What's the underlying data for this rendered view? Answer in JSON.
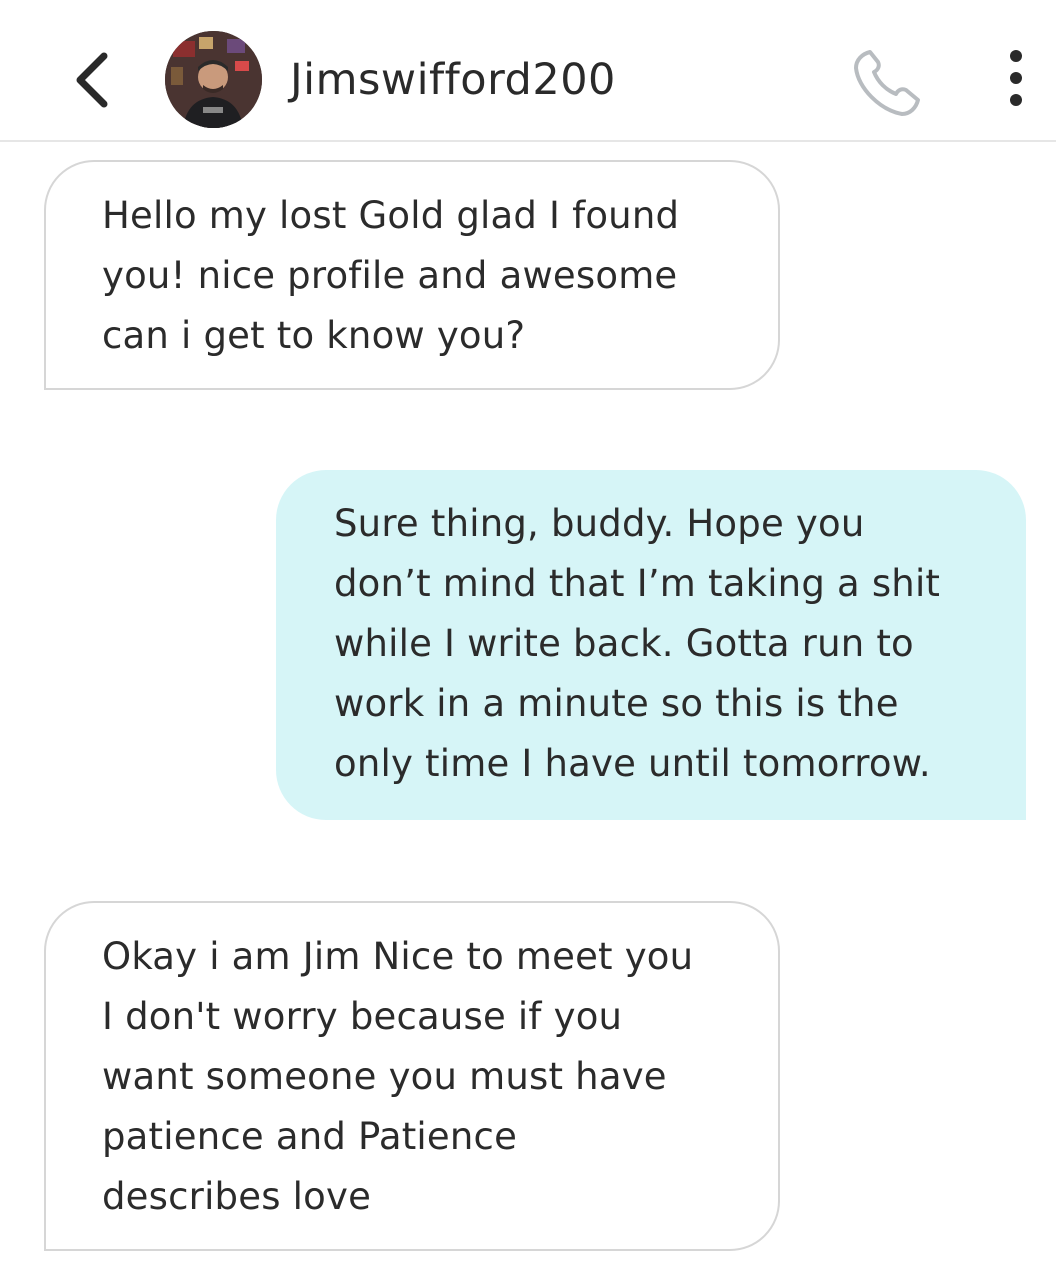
{
  "header": {
    "username": "Jimswifford200",
    "back_icon": "chevron-left-icon",
    "call_icon": "phone-icon",
    "menu_icon": "more-vertical-icon"
  },
  "messages": [
    {
      "direction": "incoming",
      "lines": [
        "Hello my lost Gold glad I found",
        "you! nice profile and awesome",
        "can i get to know you?"
      ]
    },
    {
      "direction": "outgoing",
      "lines": [
        "Sure thing, buddy. Hope you",
        "don’t mind that I’m taking a shit",
        "while I write back. Gotta run to",
        "work in a minute so this is the",
        "only time I have until tomorrow."
      ]
    },
    {
      "direction": "incoming",
      "lines": [
        "Okay i am Jim Nice to meet you",
        "I don't worry because if you",
        "want someone you must have",
        "patience and Patience",
        "describes love"
      ]
    }
  ],
  "colors": {
    "outgoing_bubble": "#d6f5f7",
    "incoming_border": "#d6d6d6",
    "divider": "#e6e6e6"
  }
}
